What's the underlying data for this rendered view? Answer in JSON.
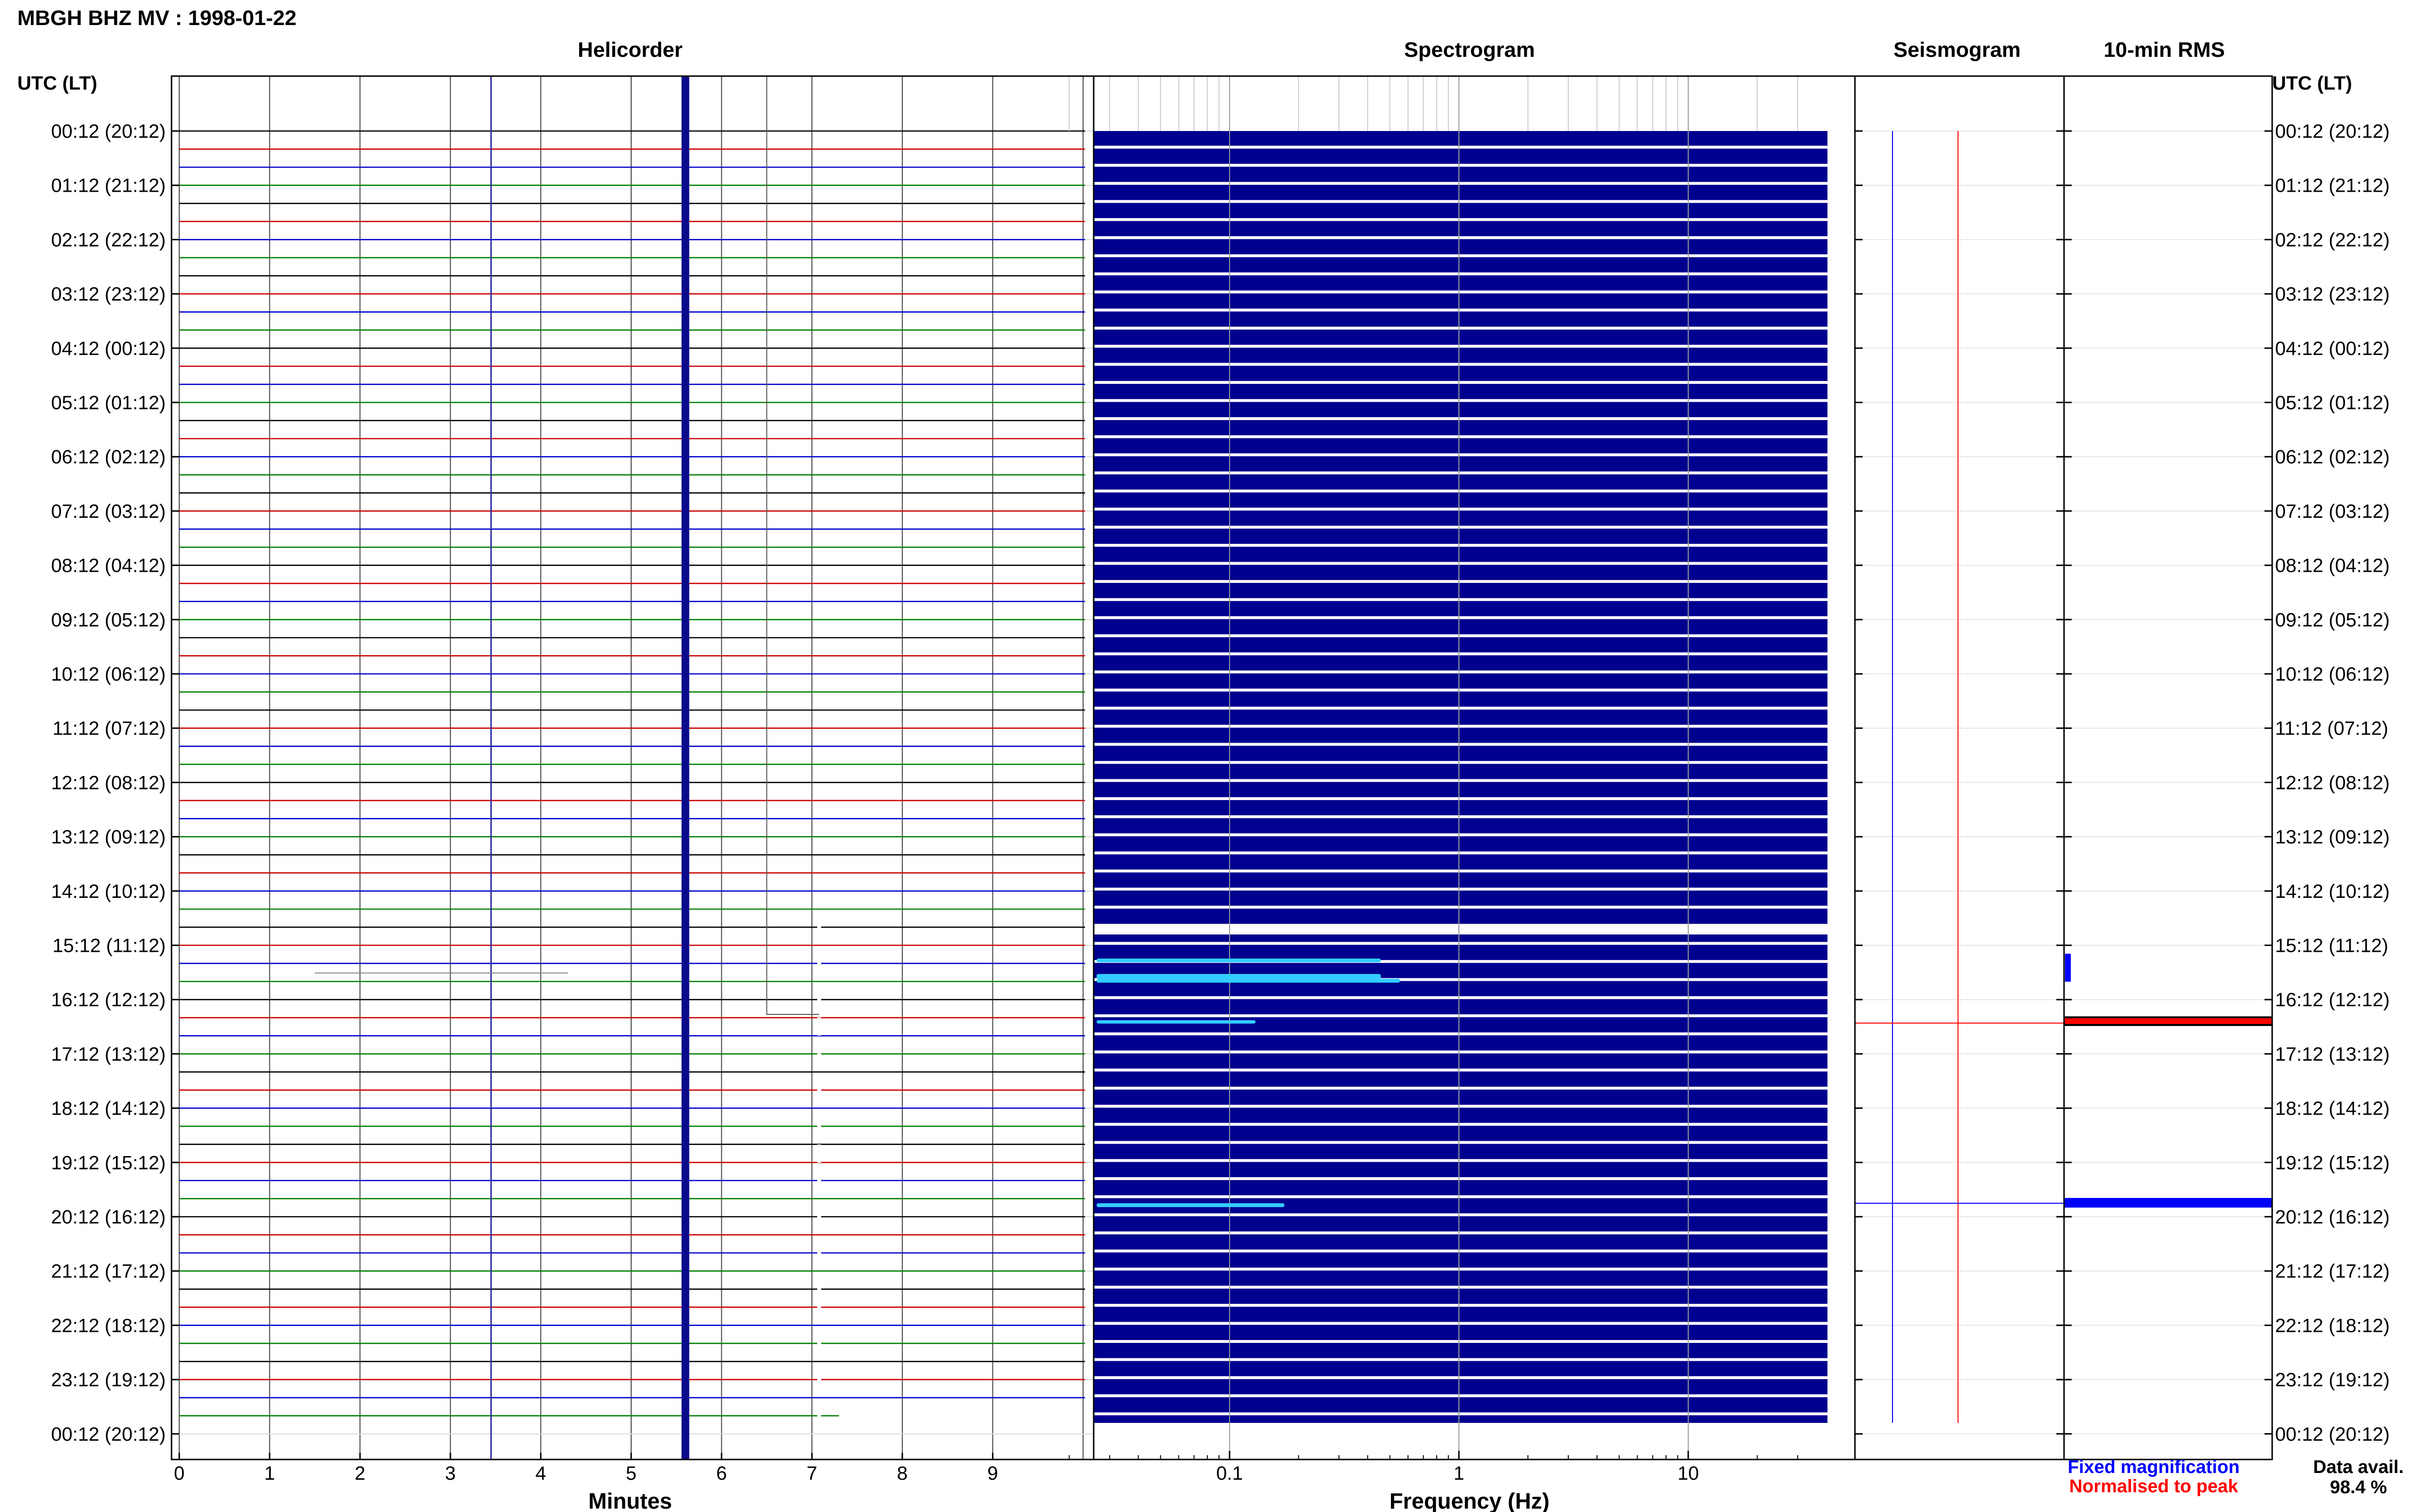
{
  "title": "MBGH BHZ MV : 1998-01-22",
  "panels": {
    "helicorder": "Helicorder",
    "spectrogram": "Spectrogram",
    "seismogram": "Seismogram",
    "rms": "10-min RMS"
  },
  "y_axis_label": "UTC (LT)",
  "time_labels": [
    "00:12 (20:12)",
    "01:12 (21:12)",
    "02:12 (22:12)",
    "03:12 (23:12)",
    "04:12 (00:12)",
    "05:12 (01:12)",
    "06:12 (02:12)",
    "07:12 (03:12)",
    "08:12 (04:12)",
    "09:12 (05:12)",
    "10:12 (06:12)",
    "11:12 (07:12)",
    "12:12 (08:12)",
    "13:12 (09:12)",
    "14:12 (10:12)",
    "15:12 (11:12)",
    "16:12 (12:12)",
    "17:12 (13:12)",
    "18:12 (14:12)",
    "19:12 (15:12)",
    "20:12 (16:12)",
    "21:12 (17:12)",
    "22:12 (18:12)",
    "23:12 (19:12)",
    "00:12 (20:12)"
  ],
  "helicorder_xlabel": "Minutes",
  "helicorder_ticks": [
    "0",
    "1",
    "2",
    "3",
    "4",
    "5",
    "6",
    "7",
    "8",
    "9"
  ],
  "spectrogram_xlabel": "Frequency (Hz)",
  "spectrogram_ticks": [
    "0.1",
    "1",
    "10"
  ],
  "legend": {
    "fixed": "Fixed magnification",
    "normalised": "Normalised to peak",
    "fixed_color": "#0000ff",
    "normalised_color": "#ff0000"
  },
  "data_avail": {
    "label": "Data avail.",
    "value": "98.4 %"
  },
  "colors": {
    "trace_cycle": [
      "#000000",
      "#cc0000",
      "#0000cc",
      "#008000"
    ],
    "spectrogram_fill": "#00008f",
    "spectrogram_hot": "#33ccff",
    "rms_fixed": "#0000ff",
    "rms_normalised": "#ff0000"
  },
  "chart_data": [
    {
      "type": "line",
      "panel": "Helicorder",
      "xlabel": "Minutes",
      "xlim": [
        0,
        10
      ],
      "rows": 72,
      "row_interval_min": 20,
      "first_row_utc": "00:12",
      "events": [
        {
          "minute": 5.6,
          "note": "persistent vertical spike through all rows"
        },
        {
          "minute": 3.45
        },
        {
          "minute": 6.5
        }
      ]
    },
    {
      "type": "heatmap",
      "panel": "Spectrogram",
      "xlabel": "Frequency (Hz)",
      "xscale": "log",
      "xlim": [
        0.01,
        50
      ],
      "active_rows_utc": [
        "15:12",
        "16:12",
        "17:12",
        "20:12"
      ]
    },
    {
      "type": "line",
      "panel": "10-min RMS",
      "series": [
        {
          "name": "Fixed magnification",
          "bursts_utc": [
            "15:12",
            "20:12"
          ]
        },
        {
          "name": "Normalised to peak",
          "bursts_utc": [
            "17:12"
          ]
        }
      ]
    }
  ]
}
